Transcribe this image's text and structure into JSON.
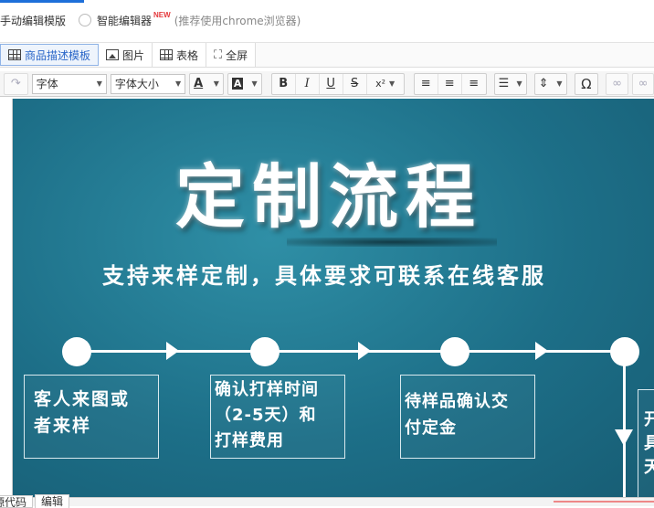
{
  "mode_bar": {
    "manual_label": "手动编辑模版",
    "smart_label": "智能编辑器",
    "new_badge": "NEW",
    "hint": "(推荐使用chrome浏览器)"
  },
  "tabs": [
    {
      "label": "商品描述模板",
      "icon": "grid-icon"
    },
    {
      "label": "图片",
      "icon": "image-icon"
    },
    {
      "label": "表格",
      "icon": "table-icon"
    },
    {
      "label": "全屏",
      "icon": "fullscreen-icon"
    }
  ],
  "toolbar": {
    "font_family": "字体",
    "font_size": "字体大小",
    "font_color_glyph": "A",
    "bg_color_glyph": "A",
    "bold": "B",
    "italic": "I",
    "underline": "U",
    "strike": "S",
    "superscript": "x²",
    "special_char": "Ω"
  },
  "banner": {
    "title": "定制流程",
    "subtitle": "支持来样定制，具体要求可联系在线客服",
    "steps": [
      {
        "line1": "客人来图或",
        "line2": "者来样",
        "line3": ""
      },
      {
        "line1": "确认打样时间",
        "line2": "（2-5天）和",
        "line3": "打样费用"
      },
      {
        "line1": "待样品确认交",
        "line2": "付定金",
        "line3": ""
      },
      {
        "line1": "开",
        "line2": "具",
        "line3": "天"
      }
    ]
  },
  "bottom_tabs": {
    "source": "源代码",
    "edit": "编辑"
  },
  "colors": {
    "banner_bg": "#1d6f88",
    "active_tab": "#2a66c8",
    "new_badge": "#e4393c"
  }
}
